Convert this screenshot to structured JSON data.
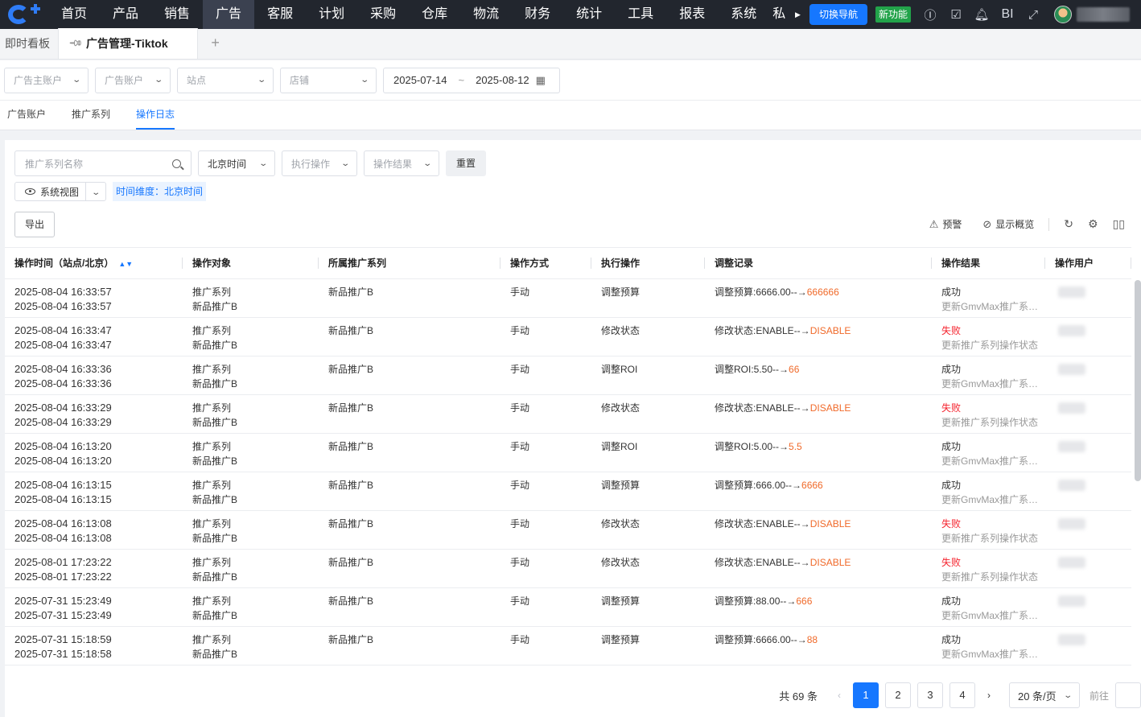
{
  "nav": {
    "items": [
      "首页",
      "产品",
      "销售",
      "广告",
      "客服",
      "计划",
      "采购",
      "仓库",
      "物流",
      "财务",
      "统计",
      "工具",
      "报表",
      "系统",
      "私"
    ],
    "active": "广告",
    "switch_label": "切换导航",
    "new_label": "新功能",
    "bi_label": "BI"
  },
  "tabs": {
    "dashboard": "即时看板",
    "current": "广告管理-Tiktok",
    "add": "+"
  },
  "filters": {
    "advertiser": "广告主账户",
    "ad_account": "广告账户",
    "site": "站点",
    "store": "店铺",
    "date_start": "2025-07-14",
    "date_sep": "~",
    "date_end": "2025-08-12"
  },
  "subtabs": [
    "广告账户",
    "推广系列",
    "操作日志"
  ],
  "toolbar": {
    "search_placeholder": "推广系列名称",
    "timezone": "北京时间",
    "exec_op": "执行操作",
    "op_result": "操作结果",
    "reset": "重置",
    "view": "系统视图",
    "time_dim": "时间维度：北京时间",
    "export": "导出",
    "alert": "预警",
    "overview": "显示概览"
  },
  "table": {
    "headers": [
      "操作时间（站点/北京）",
      "操作对象",
      "所属推广系列",
      "操作方式",
      "执行操作",
      "调整记录",
      "操作结果",
      "操作用户"
    ],
    "rows": [
      {
        "t1": "2025-08-04 16:33:57",
        "t2": "2025-08-04 16:33:57",
        "o1": "推广系列",
        "o2": "新品推广B",
        "series": "新品推广B",
        "method": "手动",
        "op": "调整预算",
        "rec": "调整预算:6666.00--→",
        "new": "666666",
        "res": "成功",
        "detail": "更新GmvMax推广系列预算",
        "fail": false
      },
      {
        "t1": "2025-08-04 16:33:47",
        "t2": "2025-08-04 16:33:47",
        "o1": "推广系列",
        "o2": "新品推广B",
        "series": "新品推广B",
        "method": "手动",
        "op": "修改状态",
        "rec": "修改状态:ENABLE--→",
        "new": "DISABLE",
        "res": "失败",
        "detail": "更新推广系列操作状态",
        "fail": true
      },
      {
        "t1": "2025-08-04 16:33:36",
        "t2": "2025-08-04 16:33:36",
        "o1": "推广系列",
        "o2": "新品推广B",
        "series": "新品推广B",
        "method": "手动",
        "op": "调整ROI",
        "rec": "调整ROI:5.50--→",
        "new": "66",
        "res": "成功",
        "detail": "更新GmvMax推广系列ROI",
        "fail": false
      },
      {
        "t1": "2025-08-04 16:33:29",
        "t2": "2025-08-04 16:33:29",
        "o1": "推广系列",
        "o2": "新品推广B",
        "series": "新品推广B",
        "method": "手动",
        "op": "修改状态",
        "rec": "修改状态:ENABLE--→",
        "new": "DISABLE",
        "res": "失败",
        "detail": "更新推广系列操作状态",
        "fail": true
      },
      {
        "t1": "2025-08-04 16:13:20",
        "t2": "2025-08-04 16:13:20",
        "o1": "推广系列",
        "o2": "新品推广B",
        "series": "新品推广B",
        "method": "手动",
        "op": "调整ROI",
        "rec": "调整ROI:5.00--→",
        "new": "5.5",
        "res": "成功",
        "detail": "更新GmvMax推广系列ROI",
        "fail": false
      },
      {
        "t1": "2025-08-04 16:13:15",
        "t2": "2025-08-04 16:13:15",
        "o1": "推广系列",
        "o2": "新品推广B",
        "series": "新品推广B",
        "method": "手动",
        "op": "调整预算",
        "rec": "调整预算:666.00--→",
        "new": "6666",
        "res": "成功",
        "detail": "更新GmvMax推广系列预算",
        "fail": false
      },
      {
        "t1": "2025-08-04 16:13:08",
        "t2": "2025-08-04 16:13:08",
        "o1": "推广系列",
        "o2": "新品推广B",
        "series": "新品推广B",
        "method": "手动",
        "op": "修改状态",
        "rec": "修改状态:ENABLE--→",
        "new": "DISABLE",
        "res": "失败",
        "detail": "更新推广系列操作状态",
        "fail": true
      },
      {
        "t1": "2025-08-01 17:23:22",
        "t2": "2025-08-01 17:23:22",
        "o1": "推广系列",
        "o2": "新品推广B",
        "series": "新品推广B",
        "method": "手动",
        "op": "修改状态",
        "rec": "修改状态:ENABLE--→",
        "new": "DISABLE",
        "res": "失败",
        "detail": "更新推广系列操作状态",
        "fail": true
      },
      {
        "t1": "2025-07-31 15:23:49",
        "t2": "2025-07-31 15:23:49",
        "o1": "推广系列",
        "o2": "新品推广B",
        "series": "新品推广B",
        "method": "手动",
        "op": "调整预算",
        "rec": "调整预算:88.00--→",
        "new": "666",
        "res": "成功",
        "detail": "更新GmvMax推广系列预算",
        "fail": false
      },
      {
        "t1": "2025-07-31 15:18:59",
        "t2": "2025-07-31 15:18:58",
        "o1": "推广系列",
        "o2": "新品推广B",
        "series": "新品推广B",
        "method": "手动",
        "op": "调整预算",
        "rec": "调整预算:6666.00--→",
        "new": "88",
        "res": "成功",
        "detail": "更新GmvMax推广系列预算",
        "fail": false
      }
    ]
  },
  "pagination": {
    "total": "共 69 条",
    "pages": [
      "1",
      "2",
      "3",
      "4"
    ],
    "active": "1",
    "size": "20 条/页",
    "goto": "前往"
  },
  "colors": {
    "accent": "#1677ff",
    "highlight": "#f06a2a",
    "fail": "#f5222d",
    "nav_bg": "#22262e",
    "new_badge": "#22a34a"
  }
}
